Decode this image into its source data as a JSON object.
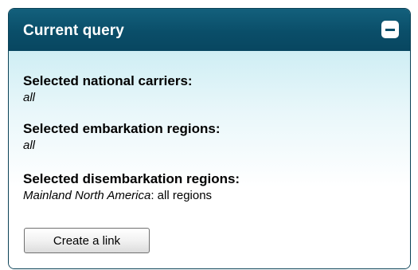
{
  "panel": {
    "title": "Current query",
    "collapse_icon": "minus-icon"
  },
  "sections": [
    {
      "label": "Selected national carriers:",
      "value_italic": "all",
      "value_rest": ""
    },
    {
      "label": "Selected embarkation regions:",
      "value_italic": "all",
      "value_rest": ""
    },
    {
      "label": "Selected disembarkation regions:",
      "value_italic": "Mainland North America",
      "value_rest": ": all regions"
    }
  ],
  "actions": {
    "create_link_label": "Create a link"
  },
  "colors": {
    "header": "#0a4e69",
    "body_gradient_top": "#cfeef4"
  }
}
